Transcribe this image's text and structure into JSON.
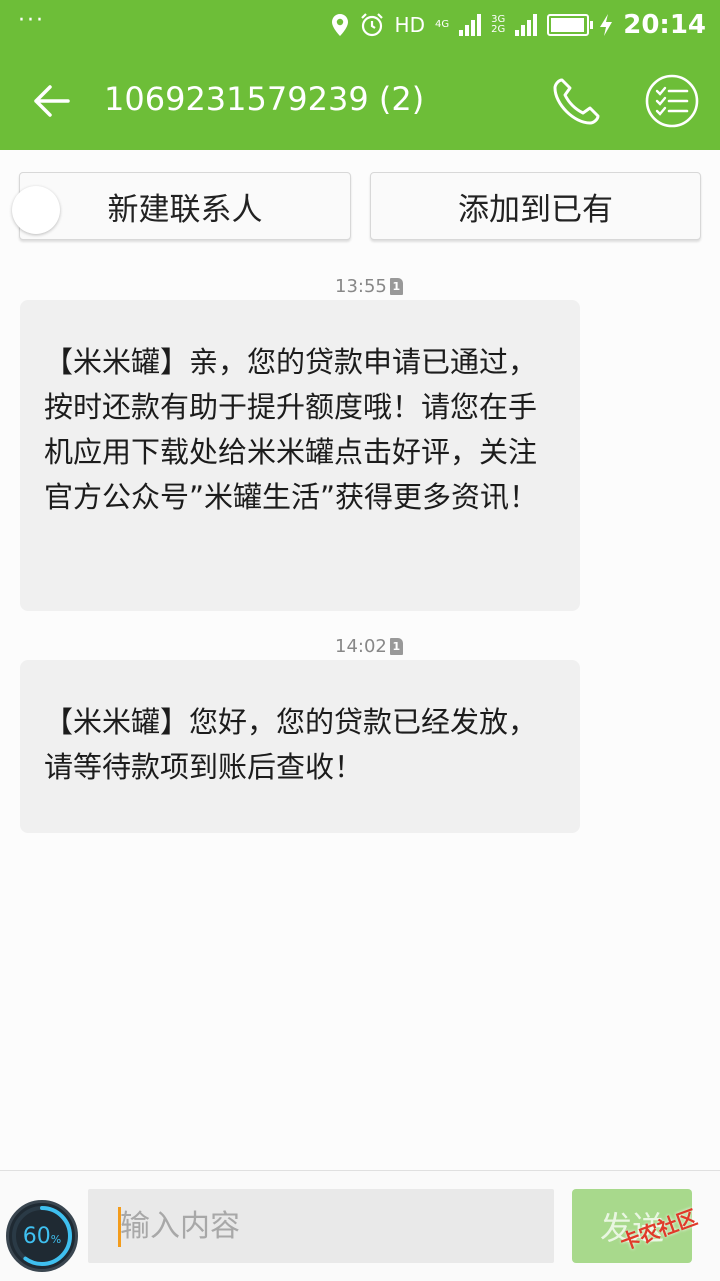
{
  "status_bar": {
    "menu_dots": "···",
    "hd": "HD",
    "network_top": "4G",
    "network_mid": "3G",
    "network_bottom": "2G",
    "battery_level": 0.95,
    "time": "20:14"
  },
  "header": {
    "title": "1069231579239 (2)"
  },
  "contact_actions": {
    "new_contact": "新建联系人",
    "add_existing": "添加到已有"
  },
  "messages": [
    {
      "time": "13:55",
      "sim": "1",
      "text": "【米米罐】亲，您的贷款申请已通过，按时还款有助于提升额度哦！请您在手机应用下载处给米米罐点击好评，关注官方公众号”米罐生活”获得更多资讯！"
    },
    {
      "time": "14:02",
      "sim": "1",
      "text": "【米米罐】您好，您的贷款已经发放，请等待款项到账后查收！"
    }
  ],
  "composer": {
    "placeholder": "输入内容",
    "send_label": "发送",
    "speed_percent": "60",
    "percent_sign": "%"
  },
  "watermark": "卡农社区",
  "colors": {
    "primary": "#6dbe38",
    "bubble": "#f0f0f0",
    "send_disabled": "#a8d98c"
  }
}
